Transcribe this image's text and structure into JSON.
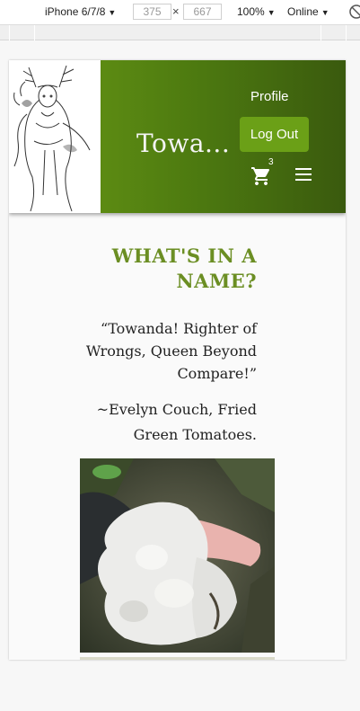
{
  "devtools": {
    "device": "iPhone 6/7/8",
    "width": "375",
    "height": "667",
    "zoom": "100%",
    "network": "Online"
  },
  "header": {
    "site_title": "Towa...",
    "profile_label": "Profile",
    "logout_label": "Log Out",
    "cart_count": "3",
    "brand_color": "#5a8a12"
  },
  "content": {
    "heading": "WHAT'S IN A NAME?",
    "quote": "“Towanda! Righter of Wrongs, Queen Beyond Compare!”",
    "attribution": "~Evelyn Couch, Fried Green Tomatoes."
  }
}
